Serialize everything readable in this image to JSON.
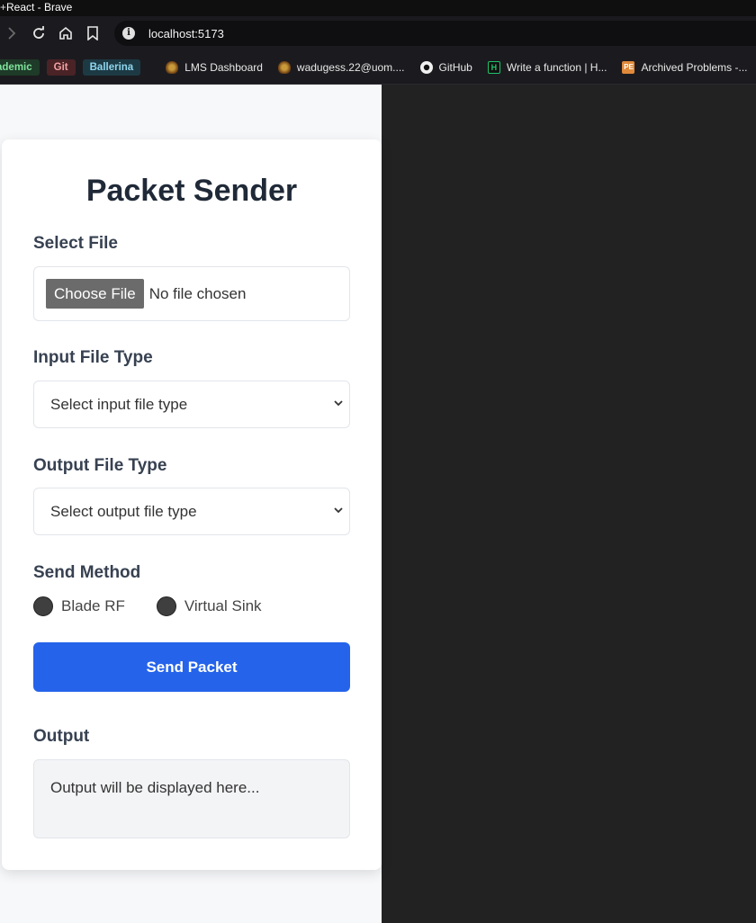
{
  "browser": {
    "window_title": "React - Brave",
    "url": "localhost:5173",
    "bookmark_chips": [
      "ademic",
      "Git",
      "Ballerina"
    ],
    "bookmarks": [
      {
        "label": "LMS Dashboard",
        "icon": "crest-icon"
      },
      {
        "label": "wadugess.22@uom....",
        "icon": "crest-icon"
      },
      {
        "label": "GitHub",
        "icon": "github-icon"
      },
      {
        "label": "Write a function | H...",
        "icon": "hackerrank-icon"
      },
      {
        "label": "Archived Problems -...",
        "icon": "projecteuler-icon"
      }
    ]
  },
  "app": {
    "title": "Packet Sender",
    "select_file_label": "Select File",
    "choose_file_button": "Choose File",
    "no_file_text": "No file chosen",
    "input_type_label": "Input File Type",
    "input_type_placeholder": "Select input file type",
    "output_type_label": "Output File Type",
    "output_type_placeholder": "Select output file type",
    "send_method_label": "Send Method",
    "send_methods": [
      "Blade RF",
      "Virtual Sink"
    ],
    "send_button": "Send Packet",
    "output_label": "Output",
    "output_placeholder": "Output will be displayed here..."
  },
  "colors": {
    "primary_button": "#2563eb",
    "page_bg": "#f7f8fa",
    "dark_bg": "#222222"
  }
}
